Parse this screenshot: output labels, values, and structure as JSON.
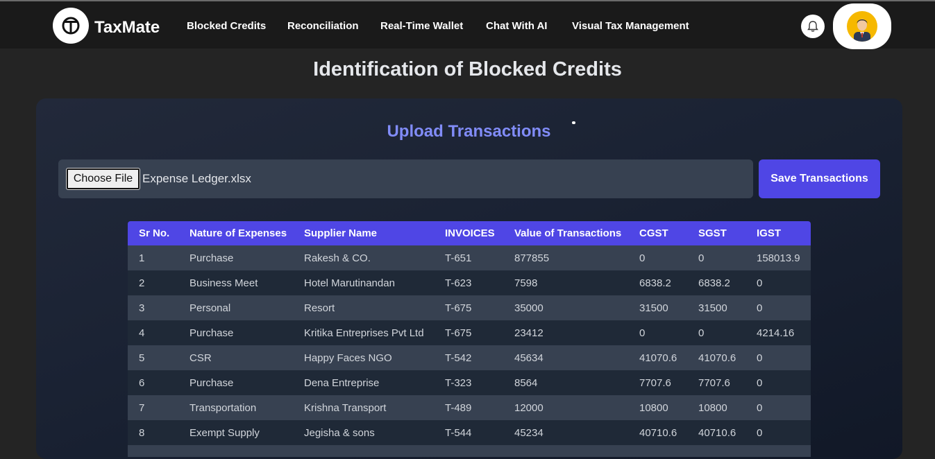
{
  "brand": {
    "name": "TaxMate"
  },
  "nav": {
    "items": [
      {
        "label": "Blocked Credits"
      },
      {
        "label": "Reconciliation"
      },
      {
        "label": "Real-Time Wallet"
      },
      {
        "label": "Chat With AI"
      },
      {
        "label": "Visual Tax Management"
      }
    ]
  },
  "page": {
    "title": "Identification of Blocked Credits"
  },
  "upload": {
    "title": "Upload Transactions",
    "choose_label": "Choose File",
    "file_name": "Expense Ledger.xlsx",
    "save_label": "Save Transactions"
  },
  "table": {
    "headers": [
      "Sr No.",
      "Nature of Expenses",
      "Supplier Name",
      "INVOICES",
      "Value of Transactions",
      "CGST",
      "SGST",
      "IGST"
    ],
    "rows": [
      [
        "1",
        "Purchase",
        "Rakesh & CO.",
        "T-651",
        "877855",
        "0",
        "0",
        "158013.9"
      ],
      [
        "2",
        "Business Meet",
        "Hotel Marutinandan",
        "T-623",
        "7598",
        "6838.2",
        "6838.2",
        "0"
      ],
      [
        "3",
        "Personal",
        "Resort",
        "T-675",
        "35000",
        "31500",
        "31500",
        "0"
      ],
      [
        "4",
        "Purchase",
        "Kritika Entreprises Pvt Ltd",
        "T-675",
        "23412",
        "0",
        "0",
        "4214.16"
      ],
      [
        "5",
        "CSR",
        "Happy Faces NGO",
        "T-542",
        "45634",
        "41070.6",
        "41070.6",
        "0"
      ],
      [
        "6",
        "Purchase",
        "Dena Entreprise",
        "T-323",
        "8564",
        "7707.6",
        "7707.6",
        "0"
      ],
      [
        "7",
        "Transportation",
        "Krishna Transport",
        "T-489",
        "12000",
        "10800",
        "10800",
        "0"
      ],
      [
        "8",
        "Exempt Supply",
        "Jegisha & sons",
        "T-544",
        "45234",
        "40710.6",
        "40710.6",
        "0"
      ]
    ]
  },
  "colors": {
    "accent": "#4f46e5",
    "upload_title": "#818cf8",
    "avatar_bg": "#f6b800"
  },
  "icons": {
    "logo": "taxmate-logo-icon",
    "notifications": "bell-icon",
    "profile": "user-avatar"
  }
}
